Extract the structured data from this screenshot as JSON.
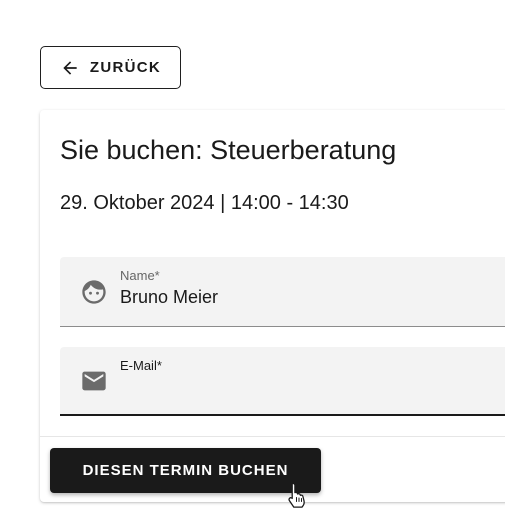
{
  "back_button": {
    "label": "ZURÜCK",
    "icon": "arrow-left-icon"
  },
  "booking": {
    "title": "Sie buchen: Steuerberatung",
    "date_time": "29. Oktober 2024 | 14:00 - 14:30"
  },
  "form": {
    "name_field": {
      "label": "Name*",
      "value": "Bruno Meier",
      "icon": "face-icon"
    },
    "email_field": {
      "label": "E-Mail*",
      "value": "",
      "icon": "mail-icon"
    }
  },
  "submit_button": {
    "label": "DIESEN TERMIN BUCHEN"
  },
  "colors": {
    "primary": "#1a1a1a",
    "field_background": "#f3f3f3",
    "icon": "#6b6b6b"
  }
}
